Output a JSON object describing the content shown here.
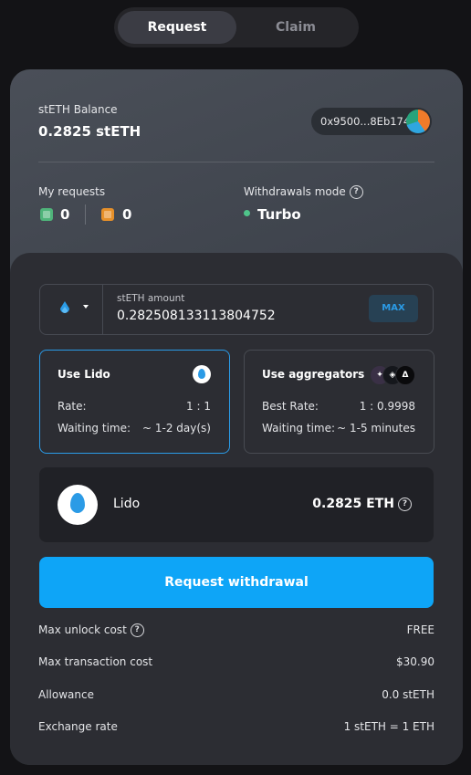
{
  "tabs": {
    "request": "Request",
    "claim": "Claim"
  },
  "balance": {
    "label": "stETH Balance",
    "value": "0.2825 stETH"
  },
  "wallet": {
    "address": "0x9500...8Eb174"
  },
  "my_requests": {
    "label": "My requests",
    "ready_count": "0",
    "pending_count": "0"
  },
  "withdrawals_mode": {
    "label": "Withdrawals mode",
    "value": "Turbo"
  },
  "amount": {
    "label": "stETH amount",
    "value": "0.282508133113804752",
    "max_label": "MAX"
  },
  "options": {
    "lido": {
      "title": "Use Lido",
      "rate_label": "Rate:",
      "rate_value": "1 : 1",
      "wait_label": "Waiting time:",
      "wait_value": "~ 1-2 day(s)"
    },
    "aggregators": {
      "title": "Use aggregators",
      "rate_label": "Best Rate:",
      "rate_value": "1 : 0.9998",
      "wait_label": "Waiting time:",
      "wait_value": "~ 1-5 minutes"
    }
  },
  "result": {
    "name": "Lido",
    "value": "0.2825 ETH"
  },
  "cta": {
    "label": "Request withdrawal"
  },
  "info": [
    {
      "label": "Max unlock cost",
      "value": "FREE"
    },
    {
      "label": "Max transaction cost",
      "value": "$30.90"
    },
    {
      "label": "Allowance",
      "value": "0.0 stETH"
    },
    {
      "label": "Exchange rate",
      "value": "1 stETH = 1 ETH"
    }
  ],
  "colors": {
    "accent": "#0ea5f7",
    "turbo_dot": "#4fc48a",
    "selected_border": "#2a9be7"
  }
}
